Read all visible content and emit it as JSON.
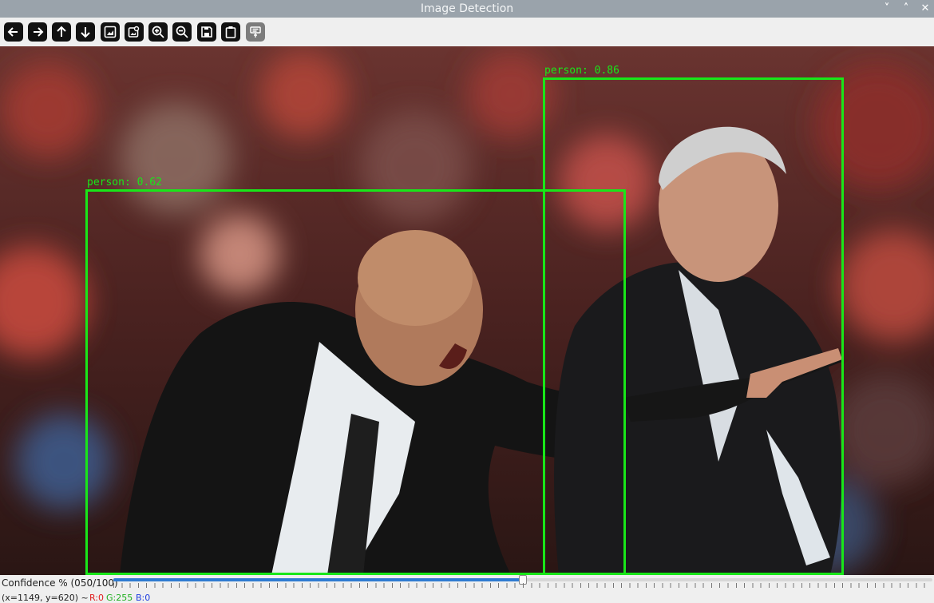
{
  "window": {
    "title": "Image Detection",
    "controls": {
      "minimize": "˅",
      "maximize": "˄",
      "close": "✕"
    }
  },
  "toolbar": {
    "buttons": [
      {
        "name": "pan-left-button",
        "icon": "arrow-left-icon"
      },
      {
        "name": "pan-right-button",
        "icon": "arrow-right-icon"
      },
      {
        "name": "pan-up-button",
        "icon": "arrow-up-icon"
      },
      {
        "name": "pan-down-button",
        "icon": "arrow-down-icon"
      },
      {
        "name": "zoom-fit-button",
        "icon": "image-icon"
      },
      {
        "name": "zoom-original-button",
        "icon": "image-search-icon"
      },
      {
        "name": "zoom-in-button",
        "icon": "zoom-in-icon"
      },
      {
        "name": "zoom-out-button",
        "icon": "zoom-out-icon"
      },
      {
        "name": "save-button",
        "icon": "save-icon"
      },
      {
        "name": "copy-to-clipboard-button",
        "icon": "clipboard-icon"
      },
      {
        "name": "properties-button",
        "icon": "properties-icon",
        "disabled": true
      }
    ]
  },
  "detections": [
    {
      "label": "person: 0.62"
    },
    {
      "label": "person: 0.86"
    }
  ],
  "confidence": {
    "label": "Confidence % (050/100)",
    "value": 50,
    "max": 100
  },
  "status": {
    "coords": "(x=1149, y=620) ~",
    "r": "R:0",
    "g": "G:255",
    "b": "B:0"
  },
  "colors": {
    "box": "#19e619",
    "slider_fill": "#2f7bd1",
    "status_r": "#e02020",
    "status_g": "#20b020",
    "status_b": "#2040e0"
  }
}
